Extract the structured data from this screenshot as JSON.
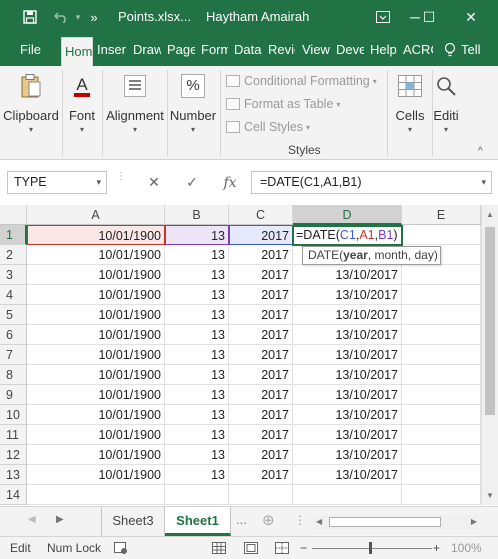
{
  "titlebar": {
    "file_name": "Points.xlsx...",
    "user_name": "Haytham Amairah",
    "save_icon": "save-icon",
    "undo_icon": "undo-icon",
    "more_icon": "»",
    "minimize": "─",
    "restore": "☐",
    "close": "✕"
  },
  "tabs": [
    "File",
    "Hom",
    "Inser",
    "Draw",
    "Page",
    "Form",
    "Data",
    "Revie",
    "View",
    "Deve",
    "Help",
    "ACRO",
    "Tell"
  ],
  "ribbon": {
    "clipboard": "Clipboard",
    "font": "Font",
    "alignment": "Alignment",
    "number": "Number",
    "number_icon": "%",
    "conditional_formatting": "Conditional Formatting",
    "format_as_table": "Format as Table",
    "cell_styles": "Cell Styles",
    "styles_group": "Styles",
    "cells": "Cells",
    "editing": "Editi",
    "arrow": "▾"
  },
  "formula_bar": {
    "name_box": "TYPE",
    "cancel": "✕",
    "enter": "✓",
    "fx": "fx",
    "formula": "=DATE(C1,A1,B1)"
  },
  "columns": [
    "A",
    "B",
    "C",
    "D",
    "E"
  ],
  "rows": [
    {
      "num": "1",
      "a": "10/01/1900",
      "b": "13",
      "c": "2017",
      "d": ""
    },
    {
      "num": "2",
      "a": "10/01/1900",
      "b": "13",
      "c": "2017",
      "d": "13/10/2017"
    },
    {
      "num": "3",
      "a": "10/01/1900",
      "b": "13",
      "c": "2017",
      "d": "13/10/2017"
    },
    {
      "num": "4",
      "a": "10/01/1900",
      "b": "13",
      "c": "2017",
      "d": "13/10/2017"
    },
    {
      "num": "5",
      "a": "10/01/1900",
      "b": "13",
      "c": "2017",
      "d": "13/10/2017"
    },
    {
      "num": "6",
      "a": "10/01/1900",
      "b": "13",
      "c": "2017",
      "d": "13/10/2017"
    },
    {
      "num": "7",
      "a": "10/01/1900",
      "b": "13",
      "c": "2017",
      "d": "13/10/2017"
    },
    {
      "num": "8",
      "a": "10/01/1900",
      "b": "13",
      "c": "2017",
      "d": "13/10/2017"
    },
    {
      "num": "9",
      "a": "10/01/1900",
      "b": "13",
      "c": "2017",
      "d": "13/10/2017"
    },
    {
      "num": "10",
      "a": "10/01/1900",
      "b": "13",
      "c": "2017",
      "d": "13/10/2017"
    },
    {
      "num": "11",
      "a": "10/01/1900",
      "b": "13",
      "c": "2017",
      "d": "13/10/2017"
    },
    {
      "num": "12",
      "a": "10/01/1900",
      "b": "13",
      "c": "2017",
      "d": "13/10/2017"
    },
    {
      "num": "13",
      "a": "10/01/1900",
      "b": "13",
      "c": "2017",
      "d": "13/10/2017"
    },
    {
      "num": "14",
      "a": "",
      "b": "",
      "c": "",
      "d": ""
    }
  ],
  "editing_cell": {
    "prefix": "=DATE(",
    "ref1": "C1",
    "comma1": ",",
    "ref2": "A1",
    "comma2": ",",
    "ref3": "B1",
    "suffix": ")"
  },
  "tooltip": {
    "fn": "DATE(",
    "arg1": "year",
    "rest": ", month, day)"
  },
  "sheets": {
    "nav_prev": "◀",
    "nav_next": "▶",
    "tabs": [
      "Sheet3",
      "Sheet1"
    ],
    "more": "...",
    "add": "⊕",
    "scroll_left": "◀",
    "scroll_right": "▶"
  },
  "status": {
    "mode": "Edit",
    "num_lock": "Num Lock",
    "zoom": "100%",
    "minus": "−",
    "plus": "+"
  },
  "colors": {
    "excel_green": "#217346",
    "ref_c1": "#3f5bdc",
    "ref_a1": "#c0392b",
    "ref_b1": "#7a3db8"
  }
}
